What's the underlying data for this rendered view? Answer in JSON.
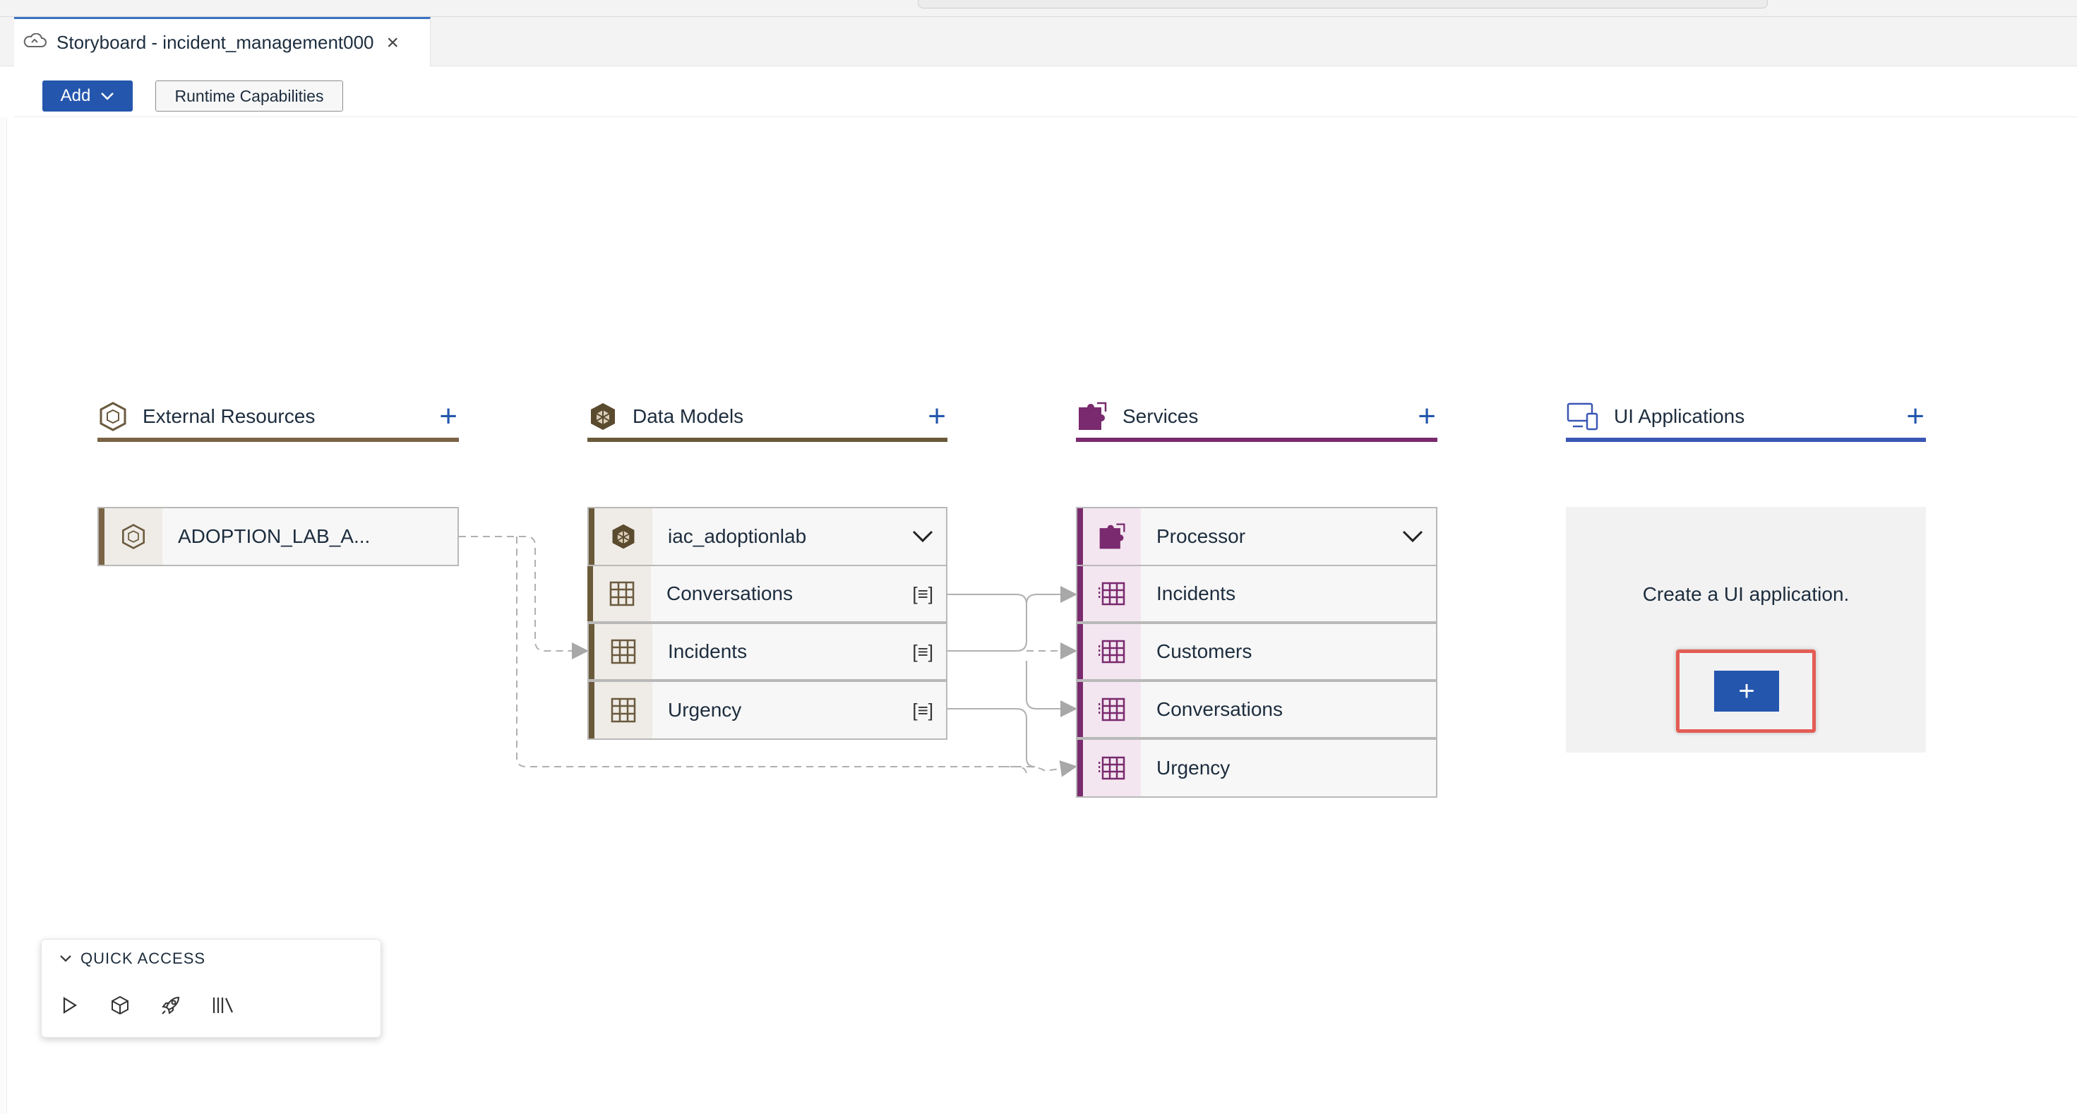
{
  "window": {
    "tab_title": "Storyboard - incident_management000"
  },
  "toolbar": {
    "add_label": "Add",
    "runtime_label": "Runtime Capabilities"
  },
  "columns": {
    "external": {
      "title": "External Resources",
      "color": "#7a6445"
    },
    "data_models": {
      "title": "Data Models",
      "color": "#6b5a3a"
    },
    "services": {
      "title": "Services",
      "color": "#7a2a6e"
    },
    "ui_apps": {
      "title": "UI Applications",
      "color": "#3b57b5"
    }
  },
  "external_node": {
    "label": "ADOPTION_LAB_A..."
  },
  "data_model": {
    "name": "iac_adoptionlab",
    "entities": [
      {
        "label": "Conversations",
        "badge": "[≡]"
      },
      {
        "label": "Incidents",
        "badge": "[≡]"
      },
      {
        "label": "Urgency",
        "badge": "[≡]"
      }
    ]
  },
  "service": {
    "name": "Processor",
    "entities": [
      {
        "label": "Incidents"
      },
      {
        "label": "Customers"
      },
      {
        "label": "Conversations"
      },
      {
        "label": "Urgency"
      }
    ]
  },
  "ui_apps": {
    "empty_text": "Create a UI application.",
    "create_label": "+"
  },
  "quick_access": {
    "title": "QUICK ACCESS",
    "icons": [
      "play-icon",
      "cube-icon",
      "rocket-icon",
      "library-icon"
    ]
  },
  "colors": {
    "accent": "#2456ad",
    "highlight": "#e35d55"
  }
}
